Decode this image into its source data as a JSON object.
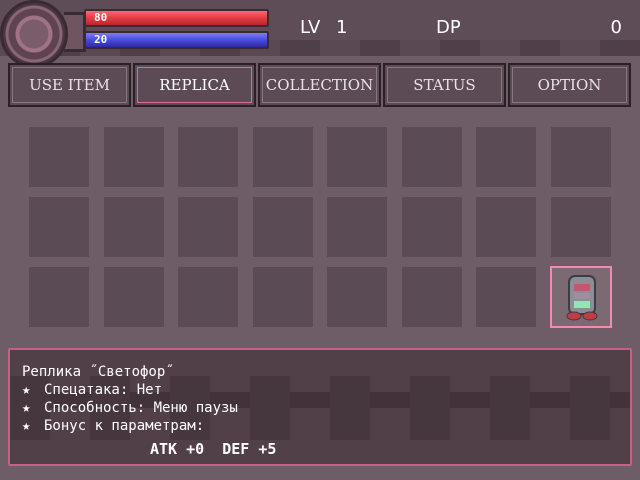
{
  "hud": {
    "hp_value": "80",
    "mp_value": "20",
    "level_label": "LV",
    "level_value": "1",
    "dp_label": "DP",
    "dp_value": "0"
  },
  "tabs": [
    {
      "label": "USE ITEM",
      "active": false
    },
    {
      "label": "REPLICA",
      "active": true
    },
    {
      "label": "COLLECTION",
      "active": false
    },
    {
      "label": "STATUS",
      "active": false
    },
    {
      "label": "OPTION",
      "active": false
    }
  ],
  "grid": {
    "rows": 3,
    "cols": 8,
    "selected_slot": "row 3, column 8",
    "filled_slot_icon": "traffic-light-replica-icon"
  },
  "description": {
    "title": "Реплика ˝Светофор˝",
    "lines": [
      {
        "bullet": "★",
        "text": "Спецатака: Нет"
      },
      {
        "bullet": "★",
        "text": "Способность: Меню паузы"
      },
      {
        "bullet": "★",
        "text": "Бонус к параметрам:"
      }
    ],
    "stats": "ATK +0  DEF +5"
  },
  "colors": {
    "background": "#6e5c66",
    "hp_bar": "#e43b43",
    "mp_bar": "#4a4ae0",
    "accent": "#f08cb4"
  }
}
